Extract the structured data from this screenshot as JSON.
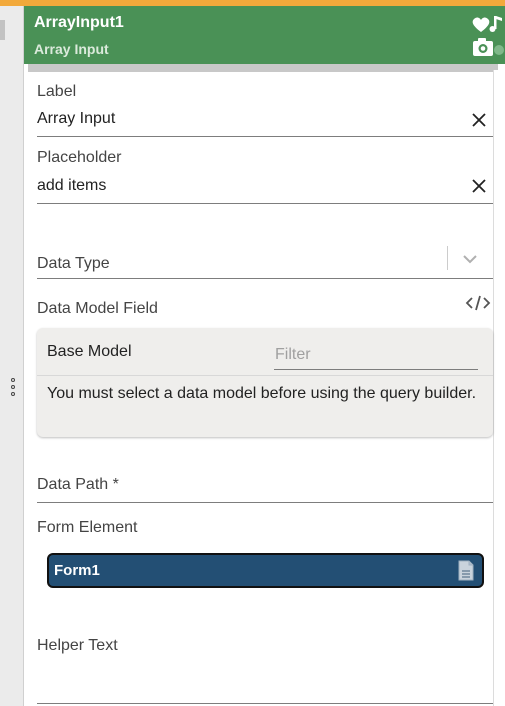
{
  "header": {
    "title": "ArrayInput1",
    "subtitle": "Array Input",
    "color": "#4a9156"
  },
  "fields": {
    "label": {
      "label": "Label",
      "value": "Array Input"
    },
    "placeholder": {
      "label": "Placeholder",
      "value": "add items"
    },
    "data_type": {
      "label": "Data Type"
    },
    "data_model_field": {
      "label": "Data Model Field"
    },
    "data_path": {
      "label": "Data Path *"
    },
    "form_element": {
      "label": "Form Element",
      "selected": "Form1",
      "chip_color": "#234f74"
    },
    "helper_text": {
      "label": "Helper Text"
    }
  },
  "query_builder": {
    "base_model_label": "Base Model",
    "filter_placeholder": "Filter",
    "message": "You must select a data model before using the query builder."
  },
  "icons": {
    "header": [
      "heart-music-icon",
      "camera-icon"
    ],
    "clear": "close-icon",
    "dropdown": "chevron-down-icon",
    "code": "code-icon",
    "document": "document-icon",
    "drag": "drag-handle-icon"
  },
  "colors": {
    "accent_top": "#f2a93b",
    "query_box_bg": "#efeeec"
  }
}
